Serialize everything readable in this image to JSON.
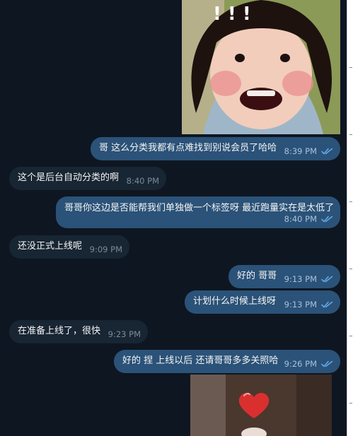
{
  "photos": [
    {
      "description_icon": "child-face-photo",
      "overlay_text": "! ! !"
    },
    {
      "description_icon": "heart-photo"
    }
  ],
  "messages": [
    {
      "direction": "out",
      "text": "哥 这么分类我都有点难找到别说会员了哈哈",
      "time": "8:39 PM",
      "read": true
    },
    {
      "direction": "in",
      "text": "这个是后台自动分类的啊",
      "time": "8:40 PM"
    },
    {
      "direction": "out",
      "text": "哥哥你这边是否能帮我们单独做一个标签呀 最近跑量实在是太低了",
      "time": "8:40 PM",
      "read": true
    },
    {
      "direction": "in",
      "text": "还没正式上线呢",
      "time": "9:09 PM"
    },
    {
      "direction": "out",
      "text": "好的 哥哥",
      "time": "9:13 PM",
      "read": true
    },
    {
      "direction": "out",
      "text": "计划什么时候上线呀",
      "time": "9:13 PM",
      "read": true
    },
    {
      "direction": "in",
      "text": "在准备上线了，很快",
      "time": "9:23 PM"
    },
    {
      "direction": "out",
      "text": "好的 捏 上线以后 还请哥哥多多关照哈",
      "time": "9:26 PM",
      "read": true
    }
  ],
  "colors": {
    "background": "#0e1621",
    "incoming_bubble": "#182533",
    "outgoing_bubble": "#2b5278",
    "read_check": "#5fa8e8"
  }
}
